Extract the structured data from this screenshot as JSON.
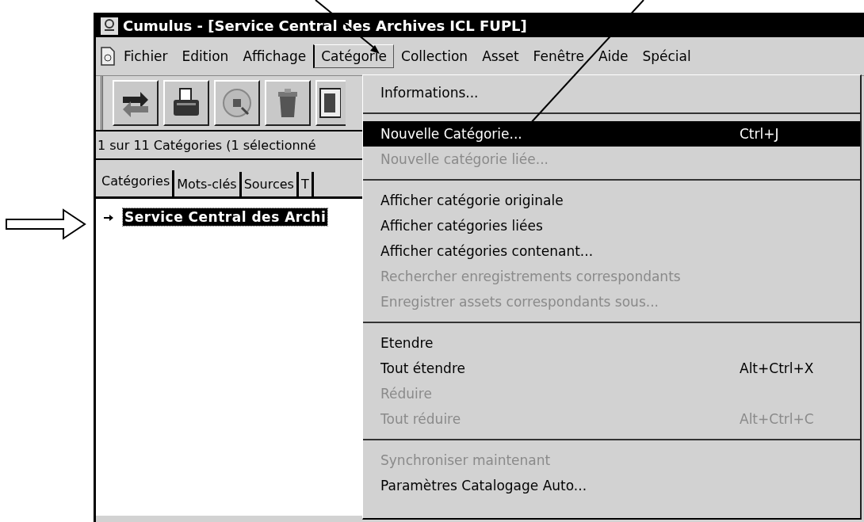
{
  "window": {
    "title": "Cumulus - [Service Central des Archives ICL FUPL]"
  },
  "menu_bar": [
    {
      "label": "Fichier",
      "selected": false
    },
    {
      "label": "Edition",
      "selected": false
    },
    {
      "label": "Affichage",
      "selected": false
    },
    {
      "label": "Catégorie",
      "selected": true
    },
    {
      "label": "Collection",
      "selected": false
    },
    {
      "label": "Asset",
      "selected": false
    },
    {
      "label": "Fenêtre",
      "selected": false
    },
    {
      "label": "Aide",
      "selected": false
    },
    {
      "label": "Spécial",
      "selected": false
    }
  ],
  "toolbar": [
    {
      "kind": "swap"
    },
    {
      "kind": "print"
    },
    {
      "kind": "disc"
    },
    {
      "kind": "trash"
    },
    {
      "kind": "list"
    }
  ],
  "status": "1 sur 11 Catégories (1 sélectionné",
  "tabs": [
    {
      "label": "Catégories",
      "selected": true
    },
    {
      "label": "Mots-clés",
      "selected": false
    },
    {
      "label": "Sources",
      "selected": false
    },
    {
      "label": "T",
      "selected": false
    }
  ],
  "tree": [
    {
      "label": "Service Central des Archi",
      "selected": true
    }
  ],
  "dropdown": [
    {
      "kind": "item",
      "label": "Informations...",
      "disabled": false,
      "selected": false
    },
    {
      "kind": "separator"
    },
    {
      "kind": "item",
      "label": "Nouvelle Catégorie...",
      "shortcut": "Ctrl+J",
      "disabled": false,
      "selected": true
    },
    {
      "kind": "item",
      "label": "Nouvelle catégorie liée...",
      "disabled": true,
      "selected": false
    },
    {
      "kind": "separator"
    },
    {
      "kind": "item",
      "label": "Afficher catégorie originale",
      "disabled": false,
      "selected": false
    },
    {
      "kind": "item",
      "label": "Afficher catégories liées",
      "disabled": false,
      "selected": false
    },
    {
      "kind": "item",
      "label": "Afficher catégories contenant...",
      "disabled": false,
      "selected": false
    },
    {
      "kind": "item",
      "label": "Rechercher enregistrements correspondants",
      "disabled": true,
      "selected": false
    },
    {
      "kind": "item",
      "label": "Enregistrer assets correspondants sous...",
      "disabled": true,
      "selected": false
    },
    {
      "kind": "separator"
    },
    {
      "kind": "item",
      "label": "Etendre",
      "disabled": false,
      "selected": false
    },
    {
      "kind": "item",
      "label": "Tout étendre",
      "shortcut": "Alt+Ctrl+X",
      "disabled": false,
      "selected": false
    },
    {
      "kind": "item",
      "label": "Réduire",
      "disabled": true,
      "selected": false
    },
    {
      "kind": "item",
      "label": "Tout réduire",
      "shortcut": "Alt+Ctrl+C",
      "disabled": true,
      "selected": false
    },
    {
      "kind": "separator"
    },
    {
      "kind": "item",
      "label": "Synchroniser maintenant",
      "disabled": true,
      "selected": false
    },
    {
      "kind": "item",
      "label": "Paramètres Catalogage Auto...",
      "disabled": false,
      "selected": false
    }
  ]
}
